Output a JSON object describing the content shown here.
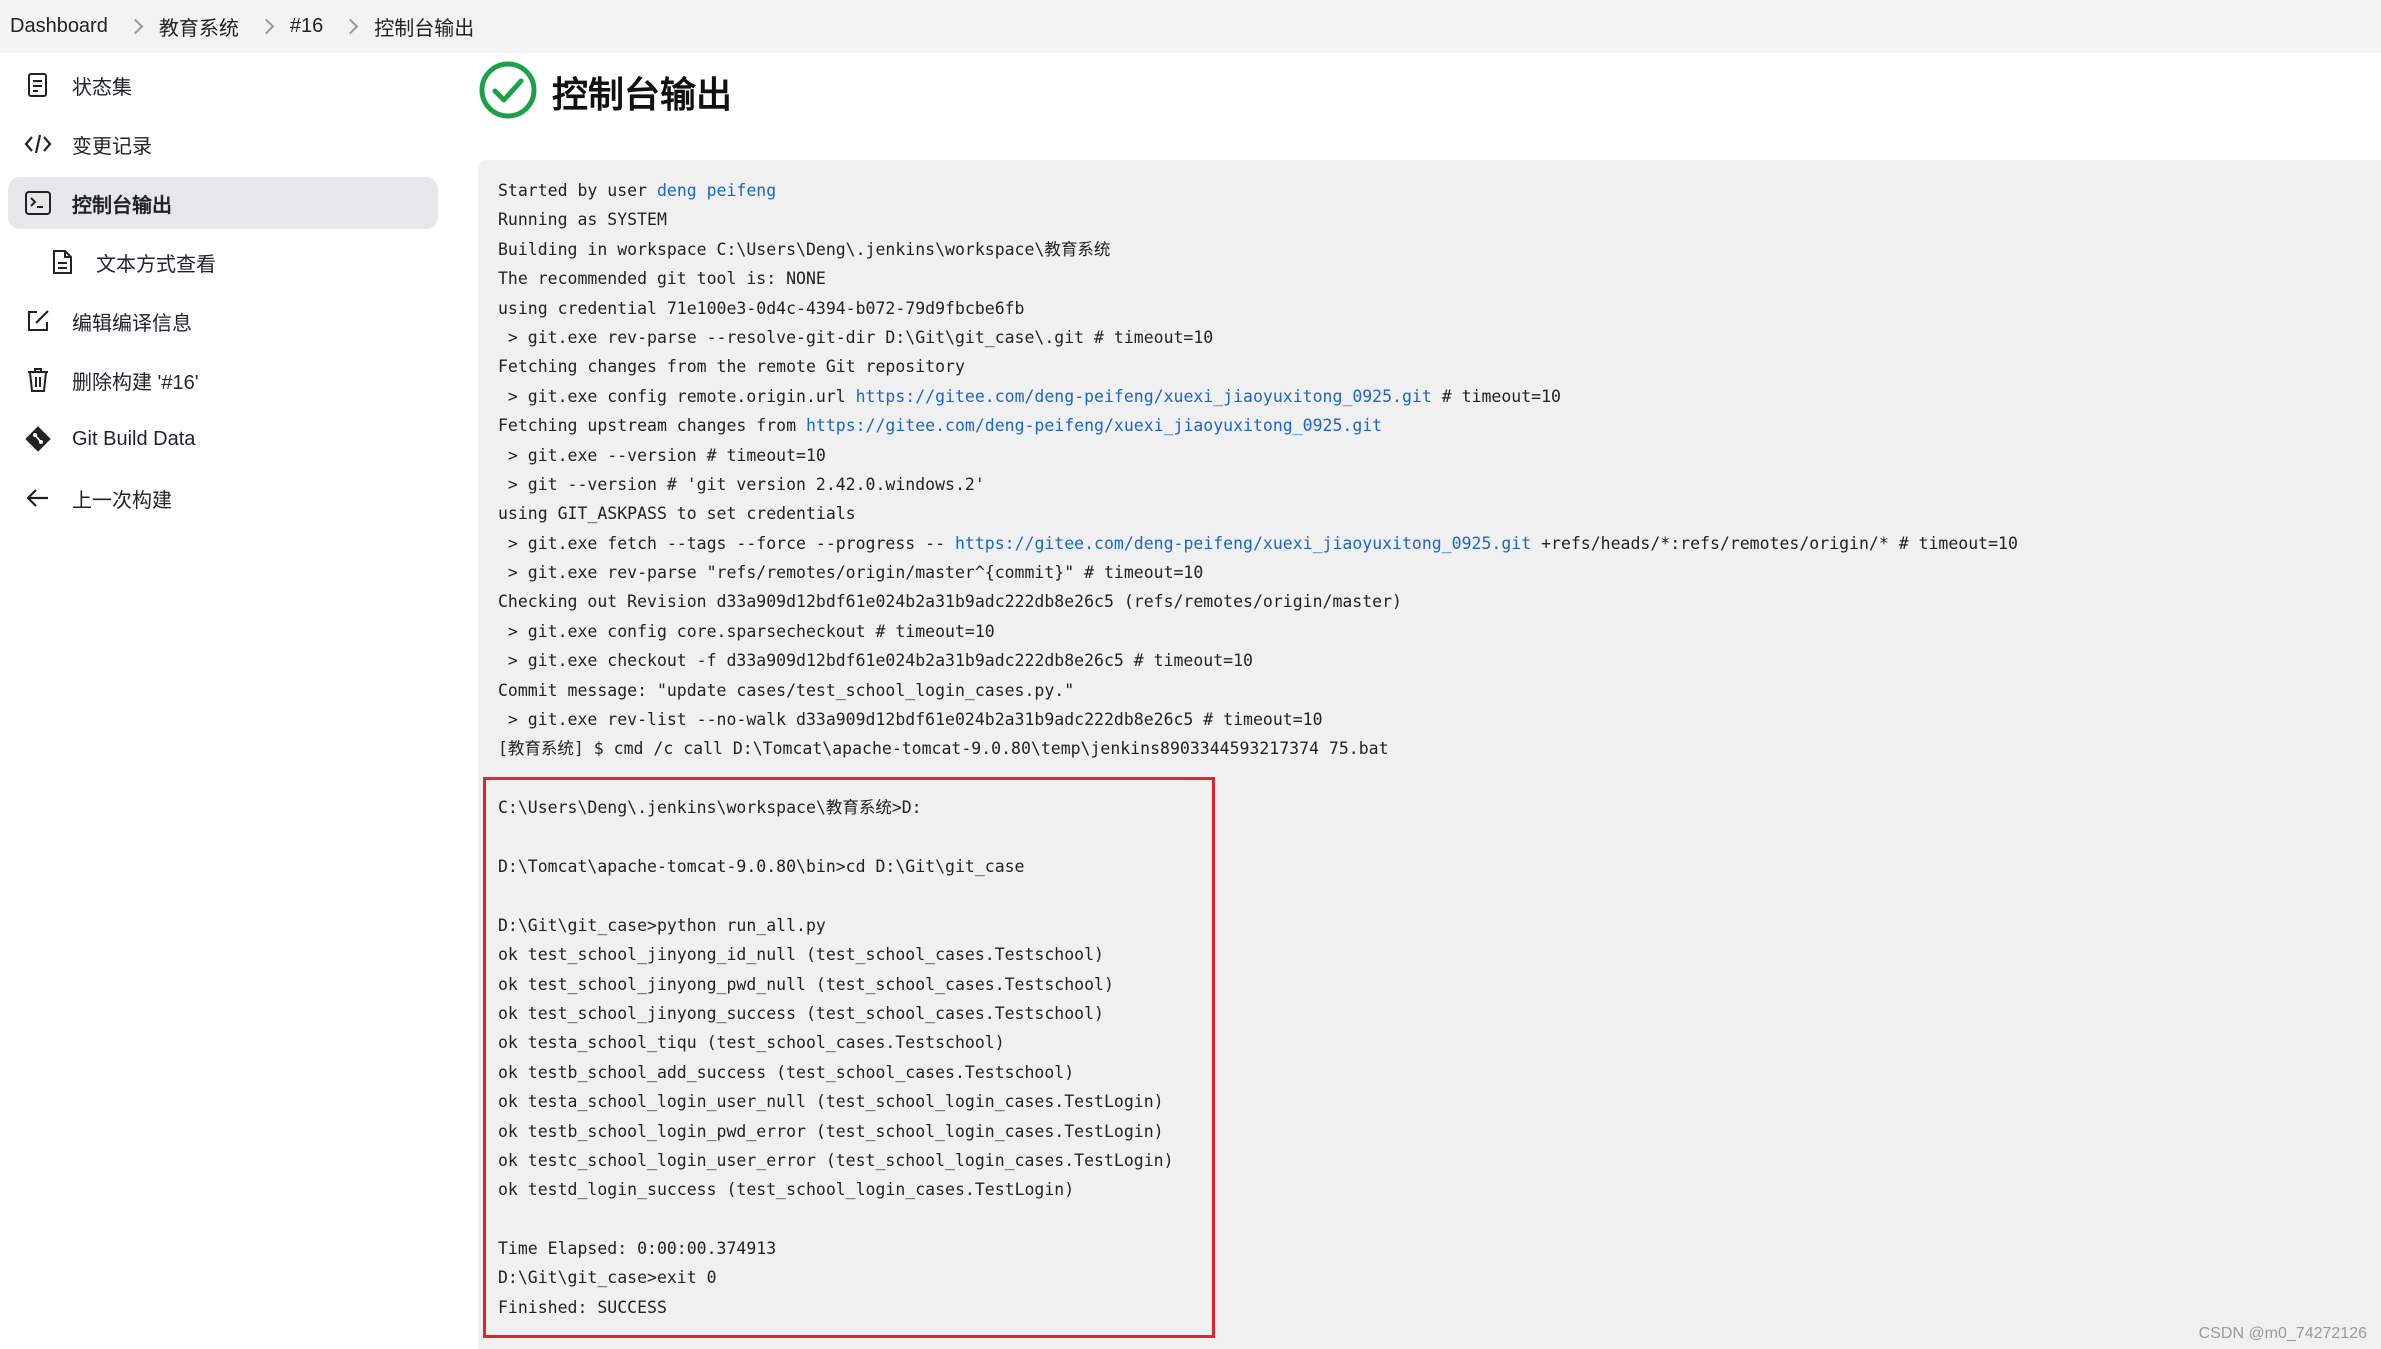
{
  "breadcrumb": [
    "Dashboard",
    "教育系统",
    "#16",
    "控制台输出"
  ],
  "sidebar": {
    "items": [
      {
        "label": "状态集",
        "icon": "document-icon"
      },
      {
        "label": "变更记录",
        "icon": "code-icon"
      },
      {
        "label": "控制台输出",
        "icon": "terminal-icon",
        "active": true
      },
      {
        "label": "文本方式查看",
        "icon": "text-file-icon",
        "sub": true
      },
      {
        "label": "编辑编译信息",
        "icon": "edit-icon"
      },
      {
        "label": "删除构建 '#16'",
        "icon": "trash-icon"
      },
      {
        "label": "Git Build Data",
        "icon": "git-icon"
      },
      {
        "label": "上一次构建",
        "icon": "arrow-left-icon"
      }
    ]
  },
  "main": {
    "title": "控制台输出",
    "status_color": "#1ea04a"
  },
  "console": {
    "lines": [
      [
        "Started by user ",
        {
          "link": "deng peifeng"
        }
      ],
      [
        "Running as SYSTEM"
      ],
      [
        "Building in workspace C:\\Users\\Deng\\.jenkins\\workspace\\教育系统"
      ],
      [
        "The recommended git tool is: NONE"
      ],
      [
        "using credential 71e100e3-0d4c-4394-b072-79d9fbcbe6fb"
      ],
      [
        " > git.exe rev-parse --resolve-git-dir D:\\Git\\git_case\\.git # timeout=10"
      ],
      [
        "Fetching changes from the remote Git repository"
      ],
      [
        " > git.exe config remote.origin.url ",
        {
          "link": "https://gitee.com/deng-peifeng/xuexi_jiaoyuxitong_0925.git"
        },
        " # timeout=10"
      ],
      [
        "Fetching upstream changes from ",
        {
          "link": "https://gitee.com/deng-peifeng/xuexi_jiaoyuxitong_0925.git"
        }
      ],
      [
        " > git.exe --version # timeout=10"
      ],
      [
        " > git --version # 'git version 2.42.0.windows.2'"
      ],
      [
        "using GIT_ASKPASS to set credentials"
      ],
      [
        " > git.exe fetch --tags --force --progress -- ",
        {
          "link": "https://gitee.com/deng-peifeng/xuexi_jiaoyuxitong_0925.git"
        },
        " +refs/heads/*:refs/remotes/origin/* # timeout=10"
      ],
      [
        " > git.exe rev-parse \"refs/remotes/origin/master^{commit}\" # timeout=10"
      ],
      [
        "Checking out Revision d33a909d12bdf61e024b2a31b9adc222db8e26c5 (refs/remotes/origin/master)"
      ],
      [
        " > git.exe config core.sparsecheckout # timeout=10"
      ],
      [
        " > git.exe checkout -f d33a909d12bdf61e024b2a31b9adc222db8e26c5 # timeout=10"
      ],
      [
        "Commit message: \"update cases/test_school_login_cases.py.\""
      ],
      [
        " > git.exe rev-list --no-walk d33a909d12bdf61e024b2a31b9adc222db8e26c5 # timeout=10"
      ],
      [
        "[教育系统] $ cmd /c call D:\\Tomcat\\apache-tomcat-9.0.80\\temp\\jenkins8903344593217374 75.bat"
      ],
      [
        ""
      ],
      [
        "C:\\Users\\Deng\\.jenkins\\workspace\\教育系统>D:"
      ],
      [
        ""
      ],
      [
        "D:\\Tomcat\\apache-tomcat-9.0.80\\bin>cd D:\\Git\\git_case"
      ],
      [
        ""
      ],
      [
        "D:\\Git\\git_case>python run_all.py"
      ],
      [
        "ok test_school_jinyong_id_null (test_school_cases.Testschool)"
      ],
      [
        "ok test_school_jinyong_pwd_null (test_school_cases.Testschool)"
      ],
      [
        "ok test_school_jinyong_success (test_school_cases.Testschool)"
      ],
      [
        "ok testa_school_tiqu (test_school_cases.Testschool)"
      ],
      [
        "ok testb_school_add_success (test_school_cases.Testschool)"
      ],
      [
        "ok testa_school_login_user_null (test_school_login_cases.TestLogin)"
      ],
      [
        "ok testb_school_login_pwd_error (test_school_login_cases.TestLogin)"
      ],
      [
        "ok testc_school_login_user_error (test_school_login_cases.TestLogin)"
      ],
      [
        "ok testd_login_success (test_school_login_cases.TestLogin)"
      ],
      [
        ""
      ],
      [
        "Time Elapsed: 0:00:00.374913"
      ],
      [
        "D:\\Git\\git_case>exit 0"
      ],
      [
        "Finished: SUCCESS"
      ]
    ]
  },
  "watermark": "CSDN @m0_74272126"
}
